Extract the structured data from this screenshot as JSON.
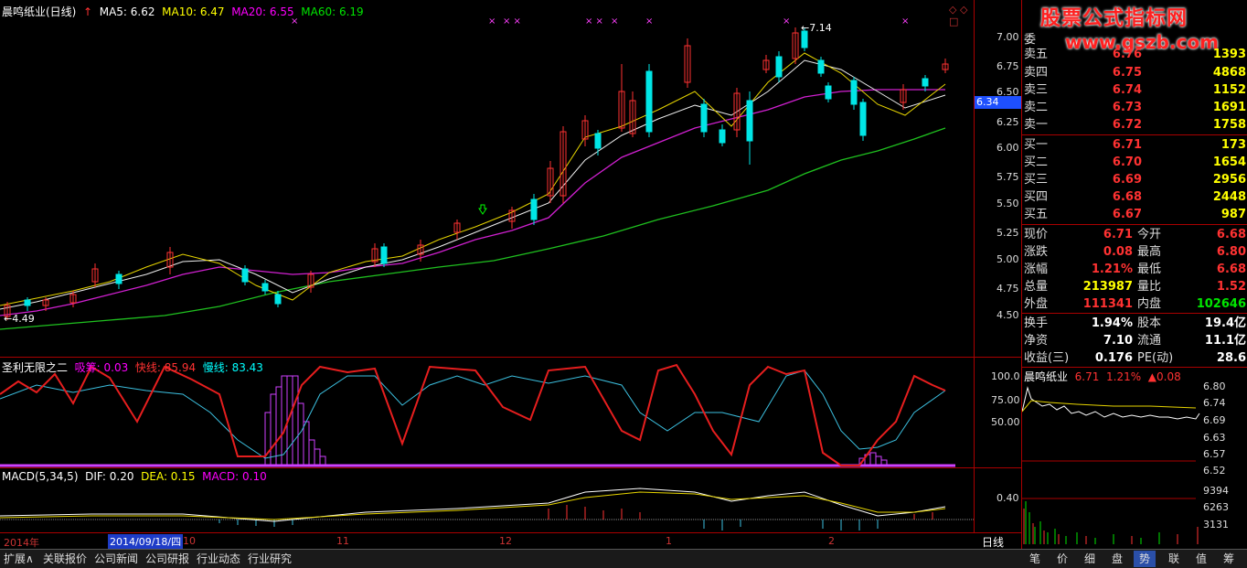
{
  "main_header": {
    "title": "晨鸣纸业(日线)",
    "ma5": "MA5: 6.62",
    "ma10": "MA10: 6.47",
    "ma20": "MA20: 6.55",
    "ma60": "MA60: 6.19"
  },
  "main_chart": {
    "y_ticks": [
      "7.00",
      "6.75",
      "6.50",
      "6.25",
      "6.00",
      "5.75",
      "5.50",
      "5.25",
      "5.00",
      "4.75",
      "4.50"
    ],
    "high_label": "7.14",
    "low_label": "4.49",
    "current_price_tag": "6.34"
  },
  "indicator_header": {
    "name": "圣利无限之二",
    "xichou": "吸筹: 0.03",
    "kuaixian": "快线: 85.94",
    "manxian": "慢线: 83.43",
    "y_ticks": [
      "100.0",
      "75.00",
      "50.00"
    ]
  },
  "macd_header": {
    "name": "MACD(5,34,5)",
    "dif": "DIF: 0.20",
    "dea": "DEA: 0.15",
    "macd": "MACD: 0.10",
    "y_tick": "0.40"
  },
  "time_axis": {
    "year": "2014年",
    "cursor_date": "2014/09/18/四",
    "months": [
      "10",
      "11",
      "12",
      "1",
      "2"
    ],
    "period": "日线"
  },
  "bottom_tabs": [
    "扩展∧",
    "关联报价",
    "公司新闻",
    "公司研报",
    "行业动态",
    "行业研究"
  ],
  "right_tabs": [
    "笔",
    "价",
    "细",
    "盘",
    "势",
    "联",
    "值",
    "筹"
  ],
  "watermark": "股票公式指标网",
  "watermark_url": "www.gszb.com",
  "order_book": {
    "header_label": "委",
    "sells": [
      {
        "label": "卖五",
        "price": "6.76",
        "vol": "1393"
      },
      {
        "label": "卖四",
        "price": "6.75",
        "vol": "4868"
      },
      {
        "label": "卖三",
        "price": "6.74",
        "vol": "1152"
      },
      {
        "label": "卖二",
        "price": "6.73",
        "vol": "1691"
      },
      {
        "label": "卖一",
        "price": "6.72",
        "vol": "1758"
      }
    ],
    "buys": [
      {
        "label": "买一",
        "price": "6.71",
        "vol": "173"
      },
      {
        "label": "买二",
        "price": "6.70",
        "vol": "1654"
      },
      {
        "label": "买三",
        "price": "6.69",
        "vol": "2956"
      },
      {
        "label": "买四",
        "price": "6.68",
        "vol": "2448"
      },
      {
        "label": "买五",
        "price": "6.67",
        "vol": "987"
      }
    ]
  },
  "quote": [
    {
      "k1": "现价",
      "v1": "6.71",
      "c1": "#ff3232",
      "k2": "今开",
      "v2": "6.68",
      "c2": "#ff3232"
    },
    {
      "k1": "涨跌",
      "v1": "0.08",
      "c1": "#ff3232",
      "k2": "最高",
      "v2": "6.80",
      "c2": "#ff3232"
    },
    {
      "k1": "涨幅",
      "v1": "1.21%",
      "c1": "#ff3232",
      "k2": "最低",
      "v2": "6.68",
      "c2": "#ff3232"
    },
    {
      "k1": "总量",
      "v1": "213987",
      "c1": "#ffff00",
      "k2": "量比",
      "v2": "1.52",
      "c2": "#ff3232"
    },
    {
      "k1": "外盘",
      "v1": "111341",
      "c1": "#ff3232",
      "k2": "内盘",
      "v2": "102646",
      "c2": "#00e600"
    }
  ],
  "fundamentals": [
    {
      "k1": "换手",
      "v1": "1.94%",
      "k2": "股本",
      "v2": "19.4亿"
    },
    {
      "k1": "净资",
      "v1": "7.10",
      "k2": "流通",
      "v2": "11.1亿"
    },
    {
      "k1": "收益(三)",
      "v1": "0.176",
      "k2": "PE(动)",
      "v2": "28.6"
    }
  ],
  "intraday": {
    "title": "晨鸣纸业",
    "price": "6.71",
    "pct": "1.21%",
    "chg": "▲0.08",
    "y_ticks": [
      "6.80",
      "6.74",
      "6.69",
      "6.63",
      "6.57",
      "6.52"
    ],
    "vol_ticks": [
      "9394",
      "6263",
      "3131"
    ]
  }
}
